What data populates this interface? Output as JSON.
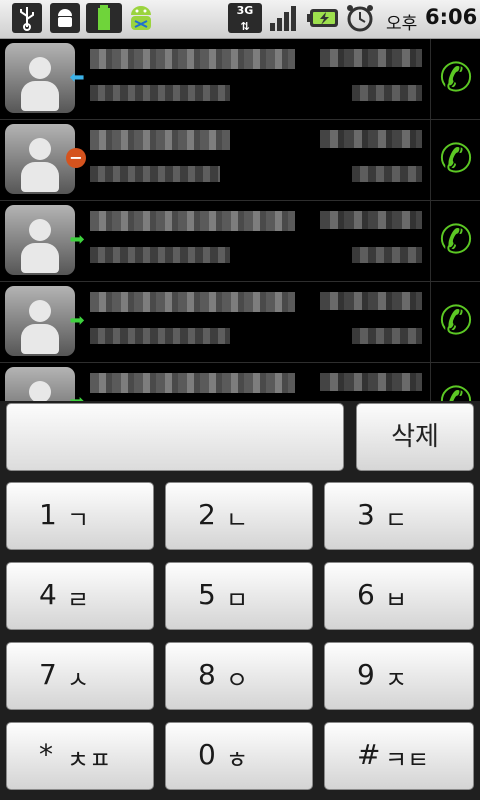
{
  "status_bar": {
    "icons": [
      "usb-icon",
      "android-debug-icon",
      "tower-app-icon",
      "bugdroid-icon",
      "network-3g-icon",
      "signal-icon",
      "battery-charging-icon",
      "alarm-icon"
    ],
    "network_label": "3G",
    "ampm": "오후",
    "time": "6:06"
  },
  "call_log": {
    "entries": [
      {
        "type": "incoming"
      },
      {
        "type": "missed"
      },
      {
        "type": "outgoing"
      },
      {
        "type": "outgoing"
      },
      {
        "type": "outgoing"
      }
    ]
  },
  "dialpad": {
    "digits_value": "",
    "delete_label": "삭제",
    "keys": [
      {
        "num": "1",
        "letters": "ㄱ"
      },
      {
        "num": "2",
        "letters": "ㄴ"
      },
      {
        "num": "3",
        "letters": "ㄷ"
      },
      {
        "num": "4",
        "letters": "ㄹ"
      },
      {
        "num": "5",
        "letters": "ㅁ"
      },
      {
        "num": "6",
        "letters": "ㅂ"
      },
      {
        "num": "7",
        "letters": "ㅅ"
      },
      {
        "num": "8",
        "letters": "ㅇ"
      },
      {
        "num": "9",
        "letters": "ㅈ"
      },
      {
        "num": "*",
        "letters": "ㅊㅍ"
      },
      {
        "num": "0",
        "letters": "ㅎ"
      },
      {
        "num": "#",
        "letters": "ㅋㅌ"
      }
    ]
  },
  "colors": {
    "call_green": "#5cc824",
    "incoming_blue": "#3cb2e8",
    "outgoing_green": "#3ed13e",
    "missed_red": "#d5531e"
  }
}
